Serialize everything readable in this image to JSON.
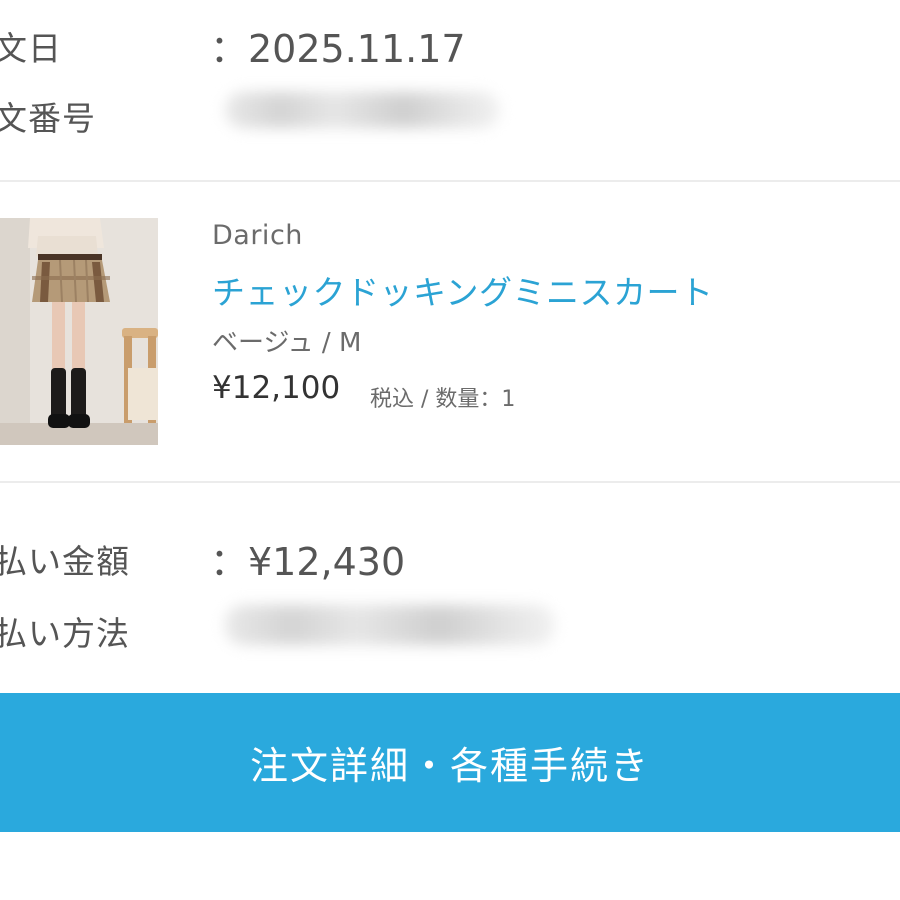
{
  "order_info": {
    "date_label": "文日",
    "date_value": "：2025.11.17",
    "number_label": "文番号"
  },
  "product": {
    "image_icon": "skirt-product-photo",
    "brand": "Darich",
    "name": "チェックドッキングミニスカート",
    "variant": "ベージュ / M",
    "price": "¥12,100",
    "price_note": "税込 / 数量：1"
  },
  "payment": {
    "amount_label": "払い金額",
    "amount_value": "：¥12,430",
    "method_label": "払い方法"
  },
  "actions": {
    "detail_button": "注文詳細・各種手続き"
  },
  "colors": {
    "accent": "#2aa9dd",
    "link": "#2ba3d4",
    "text": "#555555",
    "divider": "#ececec"
  }
}
